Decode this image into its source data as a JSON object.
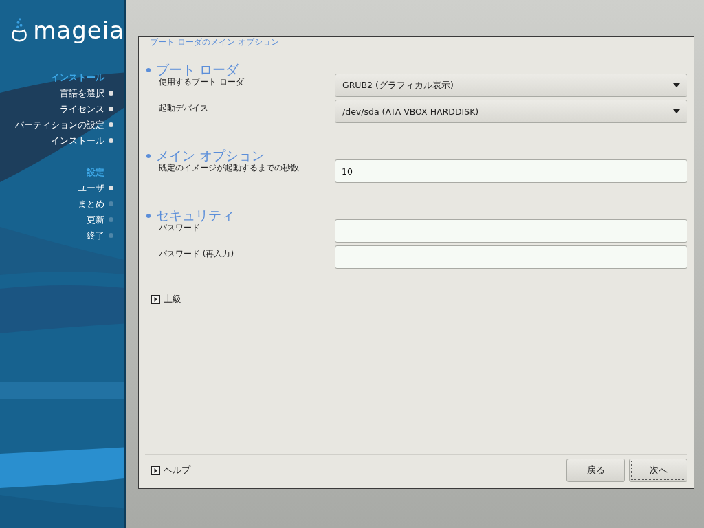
{
  "sidebar": {
    "logo": "mageia",
    "groups": [
      {
        "title": "インストール",
        "steps": [
          {
            "label": "言語を選択",
            "done": true
          },
          {
            "label": "ライセンス",
            "done": true
          },
          {
            "label": "パーティションの設定",
            "done": true
          },
          {
            "label": "インストール",
            "done": true
          }
        ]
      },
      {
        "title": "設定",
        "steps": [
          {
            "label": "ユーザ",
            "done": true
          },
          {
            "label": "まとめ",
            "done": false
          },
          {
            "label": "更新",
            "done": false
          },
          {
            "label": "終了",
            "done": false
          }
        ]
      }
    ]
  },
  "dialog": {
    "title": "ブート ローダのメイン オプション",
    "sections": [
      {
        "heading": "ブート ローダ",
        "fields": [
          {
            "kind": "dropdown",
            "label": "使用するブート ローダ",
            "value": "GRUB2 (グラフィカル表示)"
          },
          {
            "kind": "dropdown",
            "label": "起動デバイス",
            "value": "/dev/sda (ATA VBOX HARDDISK)"
          }
        ]
      },
      {
        "heading": "メイン オプション",
        "fields": [
          {
            "kind": "entry",
            "label": "既定のイメージが起動するまでの秒数",
            "value": "10"
          }
        ]
      },
      {
        "heading": "セキュリティ",
        "fields": [
          {
            "kind": "entry",
            "label": "パスワード"
          },
          {
            "kind": "entry",
            "label": "パスワード (再入力)"
          }
        ]
      }
    ],
    "advanced": {
      "label": "上級",
      "expanded": false
    },
    "help": {
      "label": "ヘルプ",
      "expanded": false
    },
    "buttons": [
      {
        "label": "戻る",
        "focused": false
      },
      {
        "label": "次へ",
        "focused": true
      }
    ]
  }
}
